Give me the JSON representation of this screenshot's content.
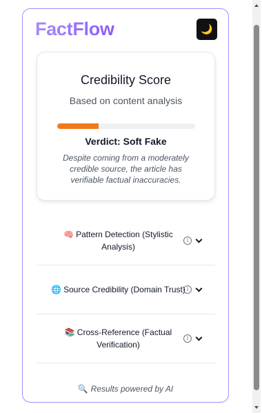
{
  "app": {
    "title": "FactFlow",
    "theme_toggle_icon": "🌙"
  },
  "score_card": {
    "title": "Credibility Score",
    "subtitle": "Based on content analysis",
    "progress_fraction": 0.3,
    "progress_color": "#f07a1a",
    "verdict": "Verdict: Soft Fake",
    "explanation": "Despite coming from a moderately credible source, the article has verifiable factual inaccuracies."
  },
  "sections": [
    {
      "emoji": "🧠",
      "label": "Pattern Detection (Stylistic Analysis)"
    },
    {
      "emoji": "🌐",
      "label": "Source Credibility (Domain Trust)"
    },
    {
      "emoji": "📚",
      "label": "Cross-Reference (Factual Verification)"
    }
  ],
  "footer": {
    "icon": "🔍",
    "text": "Results powered by AI"
  },
  "colors": {
    "brand": "#8b5cf6",
    "frame_border": "#a78bfa"
  }
}
